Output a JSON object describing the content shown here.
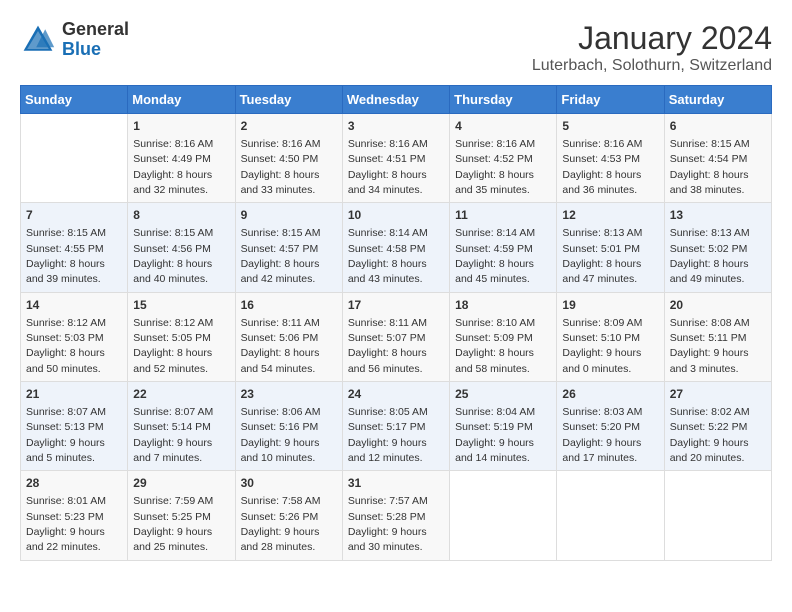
{
  "header": {
    "logo_general": "General",
    "logo_blue": "Blue",
    "title": "January 2024",
    "subtitle": "Luterbach, Solothurn, Switzerland"
  },
  "columns": [
    "Sunday",
    "Monday",
    "Tuesday",
    "Wednesday",
    "Thursday",
    "Friday",
    "Saturday"
  ],
  "weeks": [
    [
      {
        "day": "",
        "info": ""
      },
      {
        "day": "1",
        "info": "Sunrise: 8:16 AM\nSunset: 4:49 PM\nDaylight: 8 hours\nand 32 minutes."
      },
      {
        "day": "2",
        "info": "Sunrise: 8:16 AM\nSunset: 4:50 PM\nDaylight: 8 hours\nand 33 minutes."
      },
      {
        "day": "3",
        "info": "Sunrise: 8:16 AM\nSunset: 4:51 PM\nDaylight: 8 hours\nand 34 minutes."
      },
      {
        "day": "4",
        "info": "Sunrise: 8:16 AM\nSunset: 4:52 PM\nDaylight: 8 hours\nand 35 minutes."
      },
      {
        "day": "5",
        "info": "Sunrise: 8:16 AM\nSunset: 4:53 PM\nDaylight: 8 hours\nand 36 minutes."
      },
      {
        "day": "6",
        "info": "Sunrise: 8:15 AM\nSunset: 4:54 PM\nDaylight: 8 hours\nand 38 minutes."
      }
    ],
    [
      {
        "day": "7",
        "info": "Sunrise: 8:15 AM\nSunset: 4:55 PM\nDaylight: 8 hours\nand 39 minutes."
      },
      {
        "day": "8",
        "info": "Sunrise: 8:15 AM\nSunset: 4:56 PM\nDaylight: 8 hours\nand 40 minutes."
      },
      {
        "day": "9",
        "info": "Sunrise: 8:15 AM\nSunset: 4:57 PM\nDaylight: 8 hours\nand 42 minutes."
      },
      {
        "day": "10",
        "info": "Sunrise: 8:14 AM\nSunset: 4:58 PM\nDaylight: 8 hours\nand 43 minutes."
      },
      {
        "day": "11",
        "info": "Sunrise: 8:14 AM\nSunset: 4:59 PM\nDaylight: 8 hours\nand 45 minutes."
      },
      {
        "day": "12",
        "info": "Sunrise: 8:13 AM\nSunset: 5:01 PM\nDaylight: 8 hours\nand 47 minutes."
      },
      {
        "day": "13",
        "info": "Sunrise: 8:13 AM\nSunset: 5:02 PM\nDaylight: 8 hours\nand 49 minutes."
      }
    ],
    [
      {
        "day": "14",
        "info": "Sunrise: 8:12 AM\nSunset: 5:03 PM\nDaylight: 8 hours\nand 50 minutes."
      },
      {
        "day": "15",
        "info": "Sunrise: 8:12 AM\nSunset: 5:05 PM\nDaylight: 8 hours\nand 52 minutes."
      },
      {
        "day": "16",
        "info": "Sunrise: 8:11 AM\nSunset: 5:06 PM\nDaylight: 8 hours\nand 54 minutes."
      },
      {
        "day": "17",
        "info": "Sunrise: 8:11 AM\nSunset: 5:07 PM\nDaylight: 8 hours\nand 56 minutes."
      },
      {
        "day": "18",
        "info": "Sunrise: 8:10 AM\nSunset: 5:09 PM\nDaylight: 8 hours\nand 58 minutes."
      },
      {
        "day": "19",
        "info": "Sunrise: 8:09 AM\nSunset: 5:10 PM\nDaylight: 9 hours\nand 0 minutes."
      },
      {
        "day": "20",
        "info": "Sunrise: 8:08 AM\nSunset: 5:11 PM\nDaylight: 9 hours\nand 3 minutes."
      }
    ],
    [
      {
        "day": "21",
        "info": "Sunrise: 8:07 AM\nSunset: 5:13 PM\nDaylight: 9 hours\nand 5 minutes."
      },
      {
        "day": "22",
        "info": "Sunrise: 8:07 AM\nSunset: 5:14 PM\nDaylight: 9 hours\nand 7 minutes."
      },
      {
        "day": "23",
        "info": "Sunrise: 8:06 AM\nSunset: 5:16 PM\nDaylight: 9 hours\nand 10 minutes."
      },
      {
        "day": "24",
        "info": "Sunrise: 8:05 AM\nSunset: 5:17 PM\nDaylight: 9 hours\nand 12 minutes."
      },
      {
        "day": "25",
        "info": "Sunrise: 8:04 AM\nSunset: 5:19 PM\nDaylight: 9 hours\nand 14 minutes."
      },
      {
        "day": "26",
        "info": "Sunrise: 8:03 AM\nSunset: 5:20 PM\nDaylight: 9 hours\nand 17 minutes."
      },
      {
        "day": "27",
        "info": "Sunrise: 8:02 AM\nSunset: 5:22 PM\nDaylight: 9 hours\nand 20 minutes."
      }
    ],
    [
      {
        "day": "28",
        "info": "Sunrise: 8:01 AM\nSunset: 5:23 PM\nDaylight: 9 hours\nand 22 minutes."
      },
      {
        "day": "29",
        "info": "Sunrise: 7:59 AM\nSunset: 5:25 PM\nDaylight: 9 hours\nand 25 minutes."
      },
      {
        "day": "30",
        "info": "Sunrise: 7:58 AM\nSunset: 5:26 PM\nDaylight: 9 hours\nand 28 minutes."
      },
      {
        "day": "31",
        "info": "Sunrise: 7:57 AM\nSunset: 5:28 PM\nDaylight: 9 hours\nand 30 minutes."
      },
      {
        "day": "",
        "info": ""
      },
      {
        "day": "",
        "info": ""
      },
      {
        "day": "",
        "info": ""
      }
    ]
  ]
}
